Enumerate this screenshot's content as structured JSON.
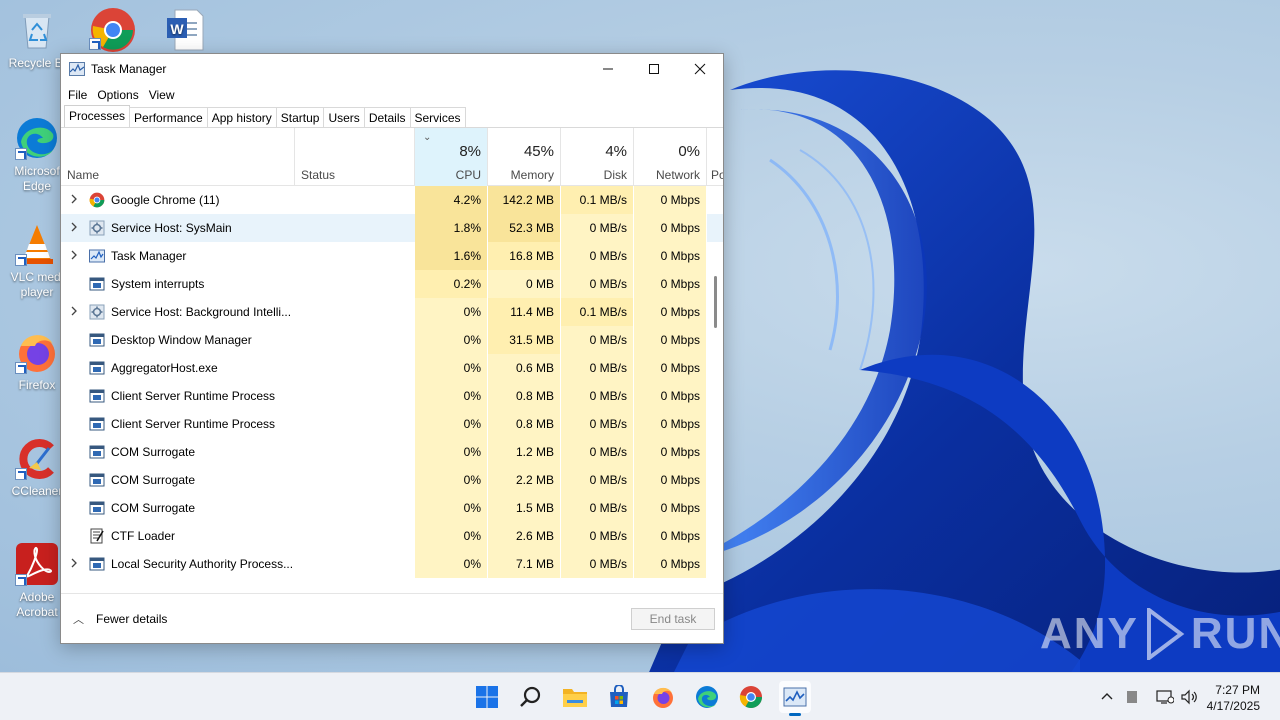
{
  "desktop": {
    "icons": [
      {
        "label": "Recycle Bin",
        "name": "recycle-bin"
      },
      {
        "label": "Google Chrome",
        "name": "chrome"
      },
      {
        "label": "Word document",
        "name": "word"
      },
      {
        "label": "Microsoft Edge",
        "name": "edge"
      },
      {
        "label": "VLC media player",
        "name": "vlc"
      },
      {
        "label": "Firefox",
        "name": "firefox"
      },
      {
        "label": "CCleaner",
        "name": "ccleaner"
      },
      {
        "label": "Adobe Acrobat",
        "name": "acrobat"
      }
    ],
    "visible_labels": {
      "recycle": "Recycle Bi",
      "edge_1": "Microsof",
      "edge_2": "Edge",
      "vlc_1": "VLC medi",
      "vlc_2": "player",
      "firefox": "Firefox",
      "ccleaner": "CCleaner",
      "acrobat_1": "Adobe",
      "acrobat_2": "Acrobat"
    },
    "watermark": {
      "left": "ANY",
      "right": "RUN"
    }
  },
  "window": {
    "title": "Task Manager",
    "buttons": {
      "minimize": "—",
      "maximize": "☐",
      "close": "✕"
    },
    "menu": [
      "File",
      "Options",
      "View"
    ],
    "tabs": [
      "Processes",
      "Performance",
      "App history",
      "Startup",
      "Users",
      "Details",
      "Services"
    ],
    "active_tab": "Processes",
    "columns": {
      "name": "Name",
      "status": "Status",
      "cpu": {
        "pct": "8%",
        "label": "CPU"
      },
      "memory": {
        "pct": "45%",
        "label": "Memory"
      },
      "disk": {
        "pct": "4%",
        "label": "Disk"
      },
      "network": {
        "pct": "0%",
        "label": "Network"
      },
      "power_partial": "Po"
    },
    "processes": [
      {
        "name": "Google Chrome (11)",
        "icon": "chrome-icon",
        "expandable": true,
        "cpu": "4.2%",
        "memory": "142.2 MB",
        "disk": "0.1 MB/s",
        "network": "0 Mbps"
      },
      {
        "name": "Service Host: SysMain",
        "icon": "gear-icon",
        "expandable": true,
        "selected": true,
        "cpu": "1.8%",
        "memory": "52.3 MB",
        "disk": "0 MB/s",
        "network": "0 Mbps"
      },
      {
        "name": "Task Manager",
        "icon": "task-manager-icon",
        "expandable": true,
        "cpu": "1.6%",
        "memory": "16.8 MB",
        "disk": "0 MB/s",
        "network": "0 Mbps"
      },
      {
        "name": "System interrupts",
        "icon": "window-icon",
        "expandable": false,
        "cpu": "0.2%",
        "memory": "0 MB",
        "disk": "0 MB/s",
        "network": "0 Mbps"
      },
      {
        "name": "Service Host: Background Intelli...",
        "icon": "gear-icon",
        "expandable": true,
        "cpu": "0%",
        "memory": "11.4 MB",
        "disk": "0.1 MB/s",
        "network": "0 Mbps"
      },
      {
        "name": "Desktop Window Manager",
        "icon": "window-icon",
        "expandable": false,
        "cpu": "0%",
        "memory": "31.5 MB",
        "disk": "0 MB/s",
        "network": "0 Mbps"
      },
      {
        "name": "AggregatorHost.exe",
        "icon": "window-icon",
        "expandable": false,
        "cpu": "0%",
        "memory": "0.6 MB",
        "disk": "0 MB/s",
        "network": "0 Mbps"
      },
      {
        "name": "Client Server Runtime Process",
        "icon": "window-icon",
        "expandable": false,
        "cpu": "0%",
        "memory": "0.8 MB",
        "disk": "0 MB/s",
        "network": "0 Mbps"
      },
      {
        "name": "Client Server Runtime Process",
        "icon": "window-icon",
        "expandable": false,
        "cpu": "0%",
        "memory": "0.8 MB",
        "disk": "0 MB/s",
        "network": "0 Mbps"
      },
      {
        "name": "COM Surrogate",
        "icon": "window-icon",
        "expandable": false,
        "cpu": "0%",
        "memory": "1.2 MB",
        "disk": "0 MB/s",
        "network": "0 Mbps"
      },
      {
        "name": "COM Surrogate",
        "icon": "window-icon",
        "expandable": false,
        "cpu": "0%",
        "memory": "2.2 MB",
        "disk": "0 MB/s",
        "network": "0 Mbps"
      },
      {
        "name": "COM Surrogate",
        "icon": "window-icon",
        "expandable": false,
        "cpu": "0%",
        "memory": "1.5 MB",
        "disk": "0 MB/s",
        "network": "0 Mbps"
      },
      {
        "name": "CTF Loader",
        "icon": "ctf-loader-icon",
        "expandable": false,
        "cpu": "0%",
        "memory": "2.6 MB",
        "disk": "0 MB/s",
        "network": "0 Mbps"
      },
      {
        "name": "Local Security Authority Process...",
        "icon": "window-icon",
        "expandable": true,
        "cpu": "0%",
        "memory": "7.1 MB",
        "disk": "0 MB/s",
        "network": "0 Mbps"
      }
    ],
    "footer": {
      "fewer_details": "Fewer details",
      "end_task": "End task"
    }
  },
  "taskbar": {
    "pinned": [
      "start-icon",
      "search-icon",
      "file-explorer-icon",
      "store-icon",
      "firefox-icon",
      "edge-icon",
      "chrome-icon",
      "task-manager-icon"
    ],
    "clock": {
      "time": "7:27 PM",
      "date": "4/17/2025"
    }
  },
  "colors": {
    "heat_low": "#fff4c4",
    "heat_mid": "#ffefb0",
    "heat_high": "#f9e49a",
    "selected_row": "#e8f3fb",
    "accent": "#0067c0"
  }
}
